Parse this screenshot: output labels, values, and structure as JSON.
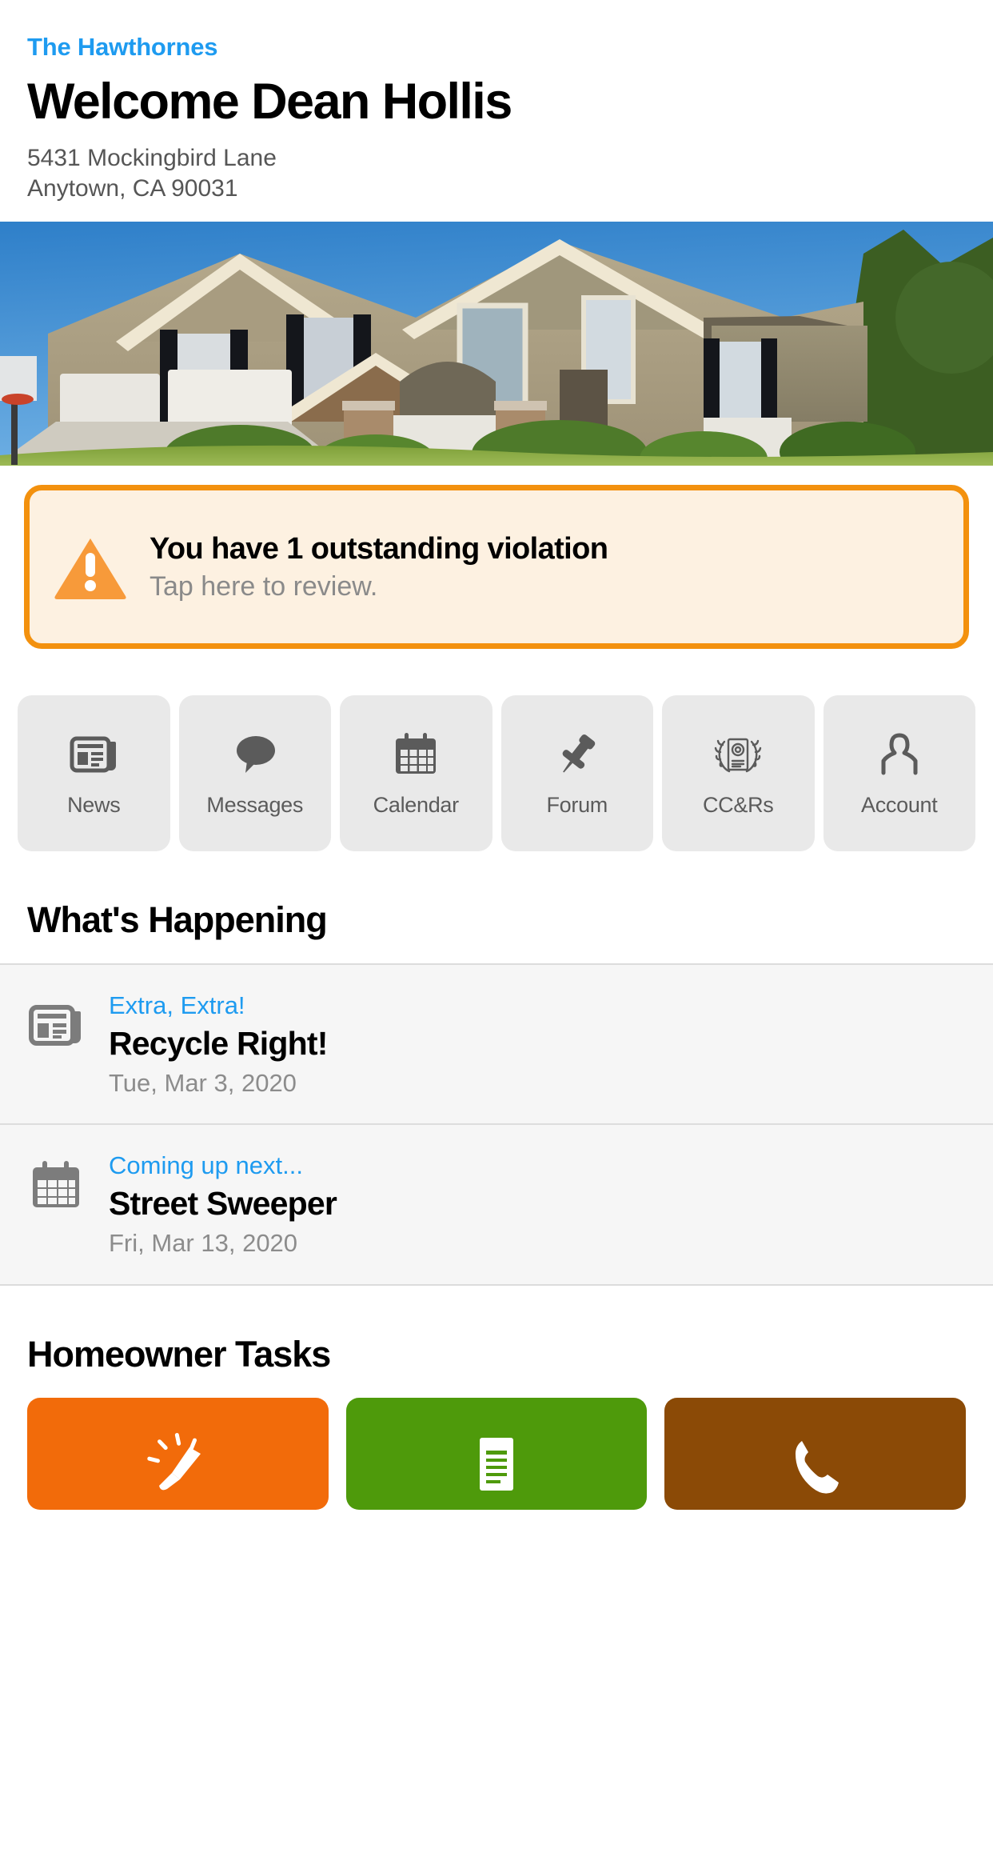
{
  "header": {
    "community_name": "The Hawthornes",
    "welcome_title": "Welcome Dean Hollis",
    "address_line1": "5431 Mockingbird Lane",
    "address_line2": "Anytown, CA 90031"
  },
  "hero": {
    "alt": "two-story beige stucco house with white garage doors and green lawn"
  },
  "violation": {
    "title": "You have 1 outstanding violation",
    "subtitle": "Tap here to review.",
    "icon": "warning-triangle-icon",
    "border_color": "#F3910E",
    "background_color": "#FDF1E1"
  },
  "tiles": [
    {
      "label": "News",
      "icon": "newspaper-icon"
    },
    {
      "label": "Messages",
      "icon": "speech-bubble-icon"
    },
    {
      "label": "Calendar",
      "icon": "calendar-icon"
    },
    {
      "label": "Forum",
      "icon": "pushpin-icon"
    },
    {
      "label": "CC&Rs",
      "icon": "certificate-laurel-icon"
    },
    {
      "label": "Account",
      "icon": "person-icon"
    }
  ],
  "whats_happening": {
    "section_title": "What's Happening",
    "items": [
      {
        "icon": "newspaper-icon",
        "kicker": "Extra, Extra!",
        "title": "Recycle Right!",
        "date": "Tue, Mar 3, 2020"
      },
      {
        "icon": "calendar-icon",
        "kicker": "Coming up next...",
        "title": "Street Sweeper",
        "date": "Fri, Mar 13, 2020"
      }
    ]
  },
  "homeowner_tasks": {
    "section_title": "Homeowner Tasks",
    "cards": [
      {
        "icon": "megaphone-icon",
        "color": "#F26B0A"
      },
      {
        "icon": "document-icon",
        "color": "#4E9A0B"
      },
      {
        "icon": "phone-icon",
        "color": "#8B4A06"
      }
    ]
  },
  "colors": {
    "accent_blue": "#1E9BF0",
    "warning_orange": "#F3910E",
    "tile_gray": "#E9E9E9",
    "panel_gray": "#F6F6F6",
    "muted_text": "#8C8C8C"
  }
}
